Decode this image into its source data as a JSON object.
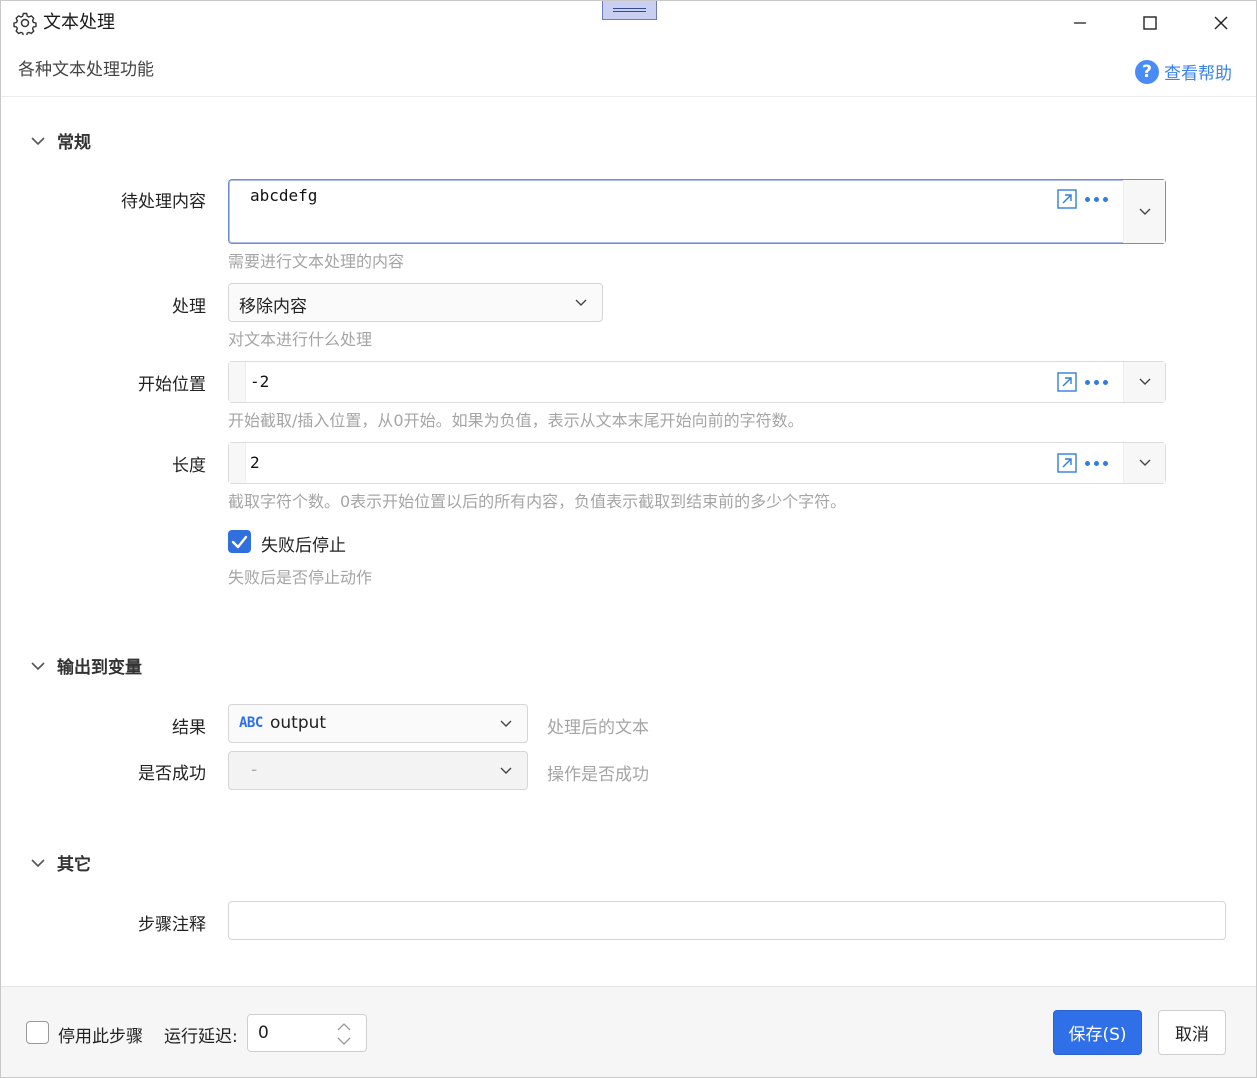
{
  "window": {
    "title": "文本处理",
    "subtitle": "各种文本处理功能",
    "help_label": "查看帮助",
    "help_glyph": "?"
  },
  "sections": {
    "general": {
      "label": "常规"
    },
    "output": {
      "label": "输出到变量"
    },
    "other": {
      "label": "其它"
    }
  },
  "fields": {
    "content": {
      "label": "待处理内容",
      "value": "abcdefg",
      "hint": "需要进行文本处理的内容"
    },
    "process": {
      "label": "处理",
      "value": "移除内容",
      "hint": "对文本进行什么处理"
    },
    "start": {
      "label": "开始位置",
      "value": "-2",
      "hint": "开始截取/插入位置，从0开始。如果为负值，表示从文本末尾开始向前的字符数。"
    },
    "length": {
      "label": "长度",
      "value": "2",
      "hint": "截取字符个数。0表示开始位置以后的所有内容，负值表示截取到结束前的多少个字符。"
    },
    "stop_on_fail": {
      "label": "失败后停止",
      "checked": true,
      "hint": "失败后是否停止动作"
    }
  },
  "output": {
    "result": {
      "label": "结果",
      "type_badge": "ABC",
      "value": "output",
      "desc": "处理后的文本"
    },
    "success": {
      "label": "是否成功",
      "value": "-",
      "desc": "操作是否成功"
    }
  },
  "other": {
    "note": {
      "label": "步骤注释",
      "value": ""
    }
  },
  "footer": {
    "disable_label": "停用此步骤",
    "disable_checked": false,
    "delay_label": "运行延迟:",
    "delay_value": "0",
    "save_label": "保存(S)",
    "cancel_label": "取消"
  },
  "colors": {
    "accent": "#2f6fe8",
    "link": "#3b82f6",
    "hint": "#a5a5a5"
  }
}
